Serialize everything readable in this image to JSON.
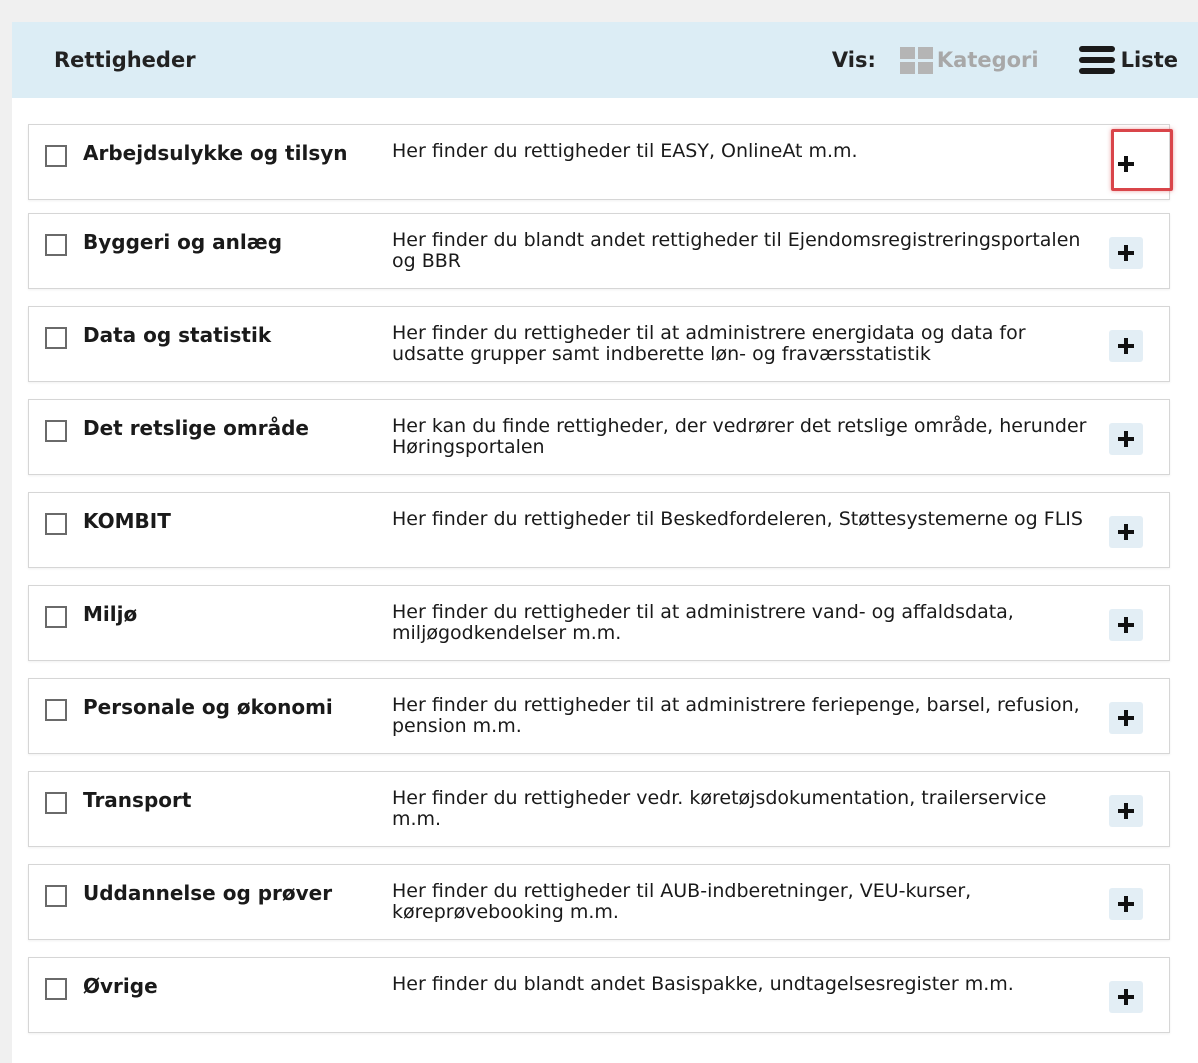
{
  "header": {
    "title": "Rettigheder",
    "vis_label": "Vis:",
    "view_category_label": "Kategori",
    "view_list_label": "Liste"
  },
  "categories": [
    {
      "name": "Arbejdsulykke og tilsyn",
      "description": "Her finder du rettigheder til EASY, OnlineAt m.m."
    },
    {
      "name": "Byggeri og anlæg",
      "description": "Her finder du blandt andet rettigheder til Ejendomsregistreringsportalen og BBR"
    },
    {
      "name": "Data og statistik",
      "description": "Her finder du rettigheder til at administrere energidata og data for udsatte grupper samt indberette løn- og fraværsstatistik"
    },
    {
      "name": "Det retslige område",
      "description": "Her kan du finde rettigheder, der vedrører det retslige område, herunder Høringsportalen"
    },
    {
      "name": "KOMBIT",
      "description": "Her finder du rettigheder til Beskedfordeleren, Støttesystemerne og FLIS"
    },
    {
      "name": "Miljø",
      "description": "Her finder du rettigheder til at administrere vand- og affaldsdata, miljøgodkendelser m.m."
    },
    {
      "name": "Personale og økonomi",
      "description": "Her finder du rettigheder til at administrere feriepenge, barsel, refusion, pension m.m."
    },
    {
      "name": "Transport",
      "description": "Her finder du rettigheder vedr. køretøjsdokumentation, trailerservice m.m."
    },
    {
      "name": "Uddannelse og prøver",
      "description": "Her finder du rettigheder til AUB-indberetninger, VEU-kurser, køreprøvebooking m.m."
    },
    {
      "name": "Øvrige",
      "description": "Her finder du blandt andet Basispakke, undtagelsesregister m.m."
    }
  ],
  "colors": {
    "header_bg": "#dcedf5",
    "highlight": "#d9454a",
    "plus_bg": "#e3eef5"
  }
}
